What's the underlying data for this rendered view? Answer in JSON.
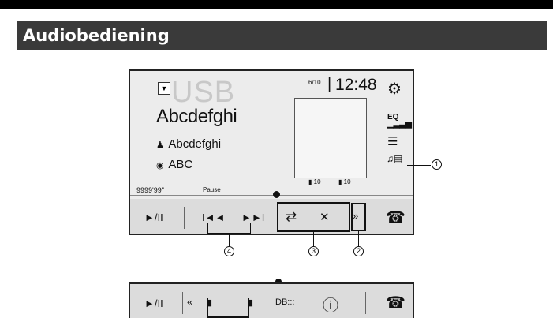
{
  "header": {
    "title": "Audiobediening"
  },
  "screen": {
    "source": "USB",
    "track_title": "Abcdefghi",
    "artist": "Abcdefghi",
    "album": "ABC",
    "track_count": "6/10",
    "clock": "12:48",
    "time_elapsed": "9999'99\"",
    "playback_status": "Pause",
    "folder_count": "10",
    "file_count": "10",
    "eq_label": "EQ"
  },
  "controls": {
    "play_pause": "►/II",
    "prev": "I◄◄",
    "next": "►►I",
    "repeat": "⇄",
    "shuffle": "✕",
    "more": "»",
    "phone": "☎"
  },
  "callouts": {
    "c1": "1",
    "c2": "2",
    "c3": "3",
    "c4": "4"
  },
  "bar2": {
    "play_pause": "►/II",
    "back": "«",
    "db_label": "DB:::",
    "info": "ⓘ",
    "phone": "☎"
  }
}
